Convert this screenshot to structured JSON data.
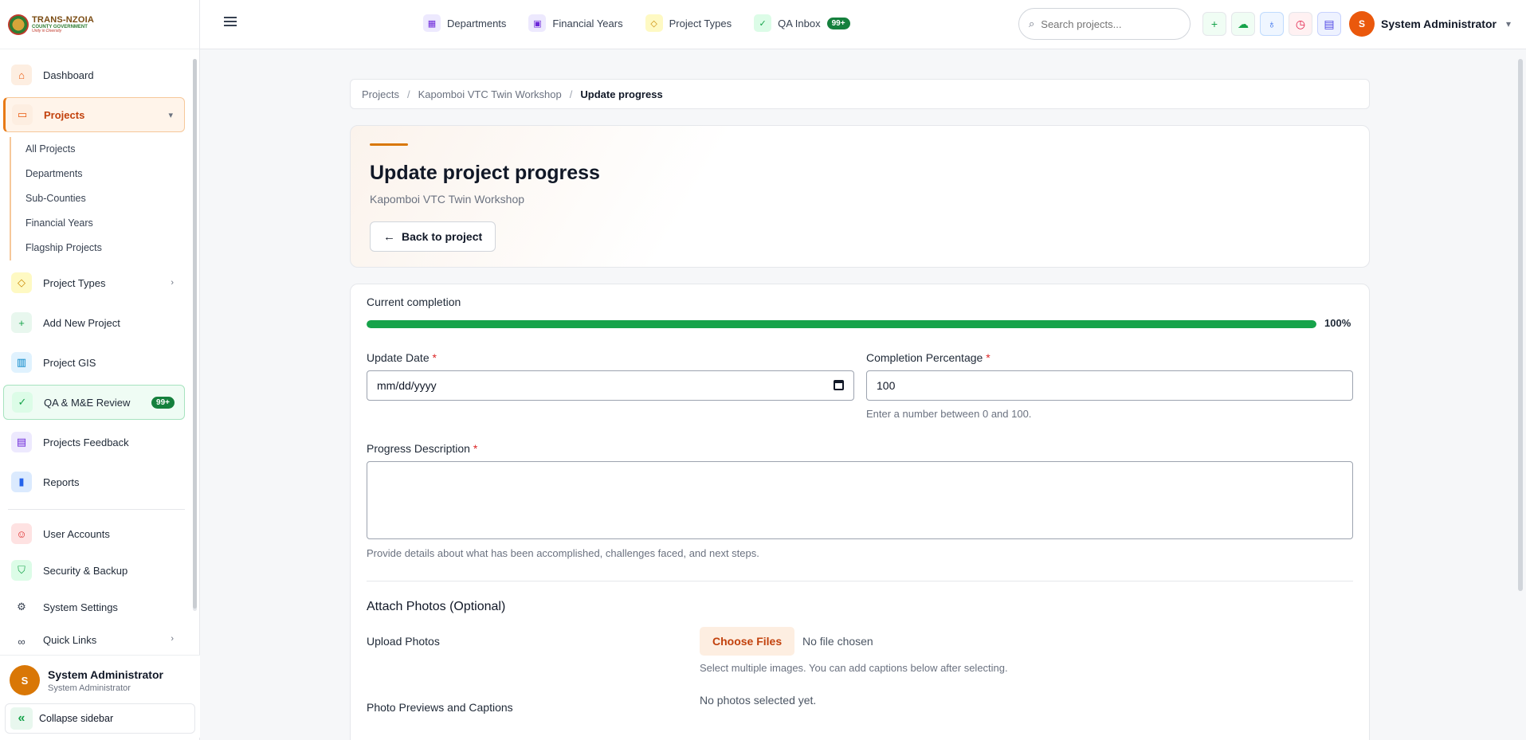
{
  "logo": {
    "line1": "TRANS-NZOIA",
    "line2": "COUNTY GOVERNMENT",
    "line3": "Unity in Diversity"
  },
  "sidebar": {
    "items": [
      {
        "label": "Dashboard"
      },
      {
        "label": "Projects"
      },
      {
        "label": "Project Types"
      },
      {
        "label": "Add New Project"
      },
      {
        "label": "Project GIS"
      },
      {
        "label": "QA & M&E Review",
        "badge": "99+"
      },
      {
        "label": "Projects Feedback"
      },
      {
        "label": "Reports"
      },
      {
        "label": "User Accounts"
      },
      {
        "label": "Security & Backup"
      },
      {
        "label": "System Settings"
      },
      {
        "label": "Quick Links"
      }
    ],
    "submenu": [
      "All Projects",
      "Departments",
      "Sub-Counties",
      "Financial Years",
      "Flagship Projects"
    ],
    "user": {
      "name": "System Administrator",
      "role": "System Administrator",
      "initial": "S"
    },
    "collapse_label": "Collapse sidebar"
  },
  "topbar": {
    "links": [
      {
        "label": "Departments"
      },
      {
        "label": "Financial Years"
      },
      {
        "label": "Project Types"
      },
      {
        "label": "QA Inbox",
        "badge": "99+"
      }
    ],
    "search_placeholder": "Search projects...",
    "account": {
      "name": "System Administrator",
      "initial": "S"
    }
  },
  "breadcrumb": [
    "Projects",
    "Kapomboi VTC Twin Workshop",
    "Update progress"
  ],
  "hero": {
    "title": "Update project progress",
    "subtitle": "Kapomboi VTC Twin Workshop",
    "back_label": "Back to project"
  },
  "form": {
    "current_completion_label": "Current completion",
    "current_completion": 100,
    "current_completion_text": "100%",
    "update_date_label": "Update Date",
    "update_date_placeholder": "mm/dd/yyyy",
    "completion_label": "Completion Percentage",
    "completion_value": "100",
    "completion_help": "Enter a number between 0 and 100.",
    "description_label": "Progress Description",
    "description_help": "Provide details about what has been accomplished, challenges faced, and next steps.",
    "photos_section": "Attach Photos (Optional)",
    "upload_label": "Upload Photos",
    "choose_files": "Choose Files",
    "no_file": "No file chosen",
    "upload_help": "Select multiple images. You can add captions below after selecting.",
    "previews_label": "Photo Previews and Captions",
    "no_photos": "No photos selected yet."
  },
  "colors": {
    "accent": "#e87a16",
    "success": "#16a34a",
    "badge": "#15803d"
  }
}
